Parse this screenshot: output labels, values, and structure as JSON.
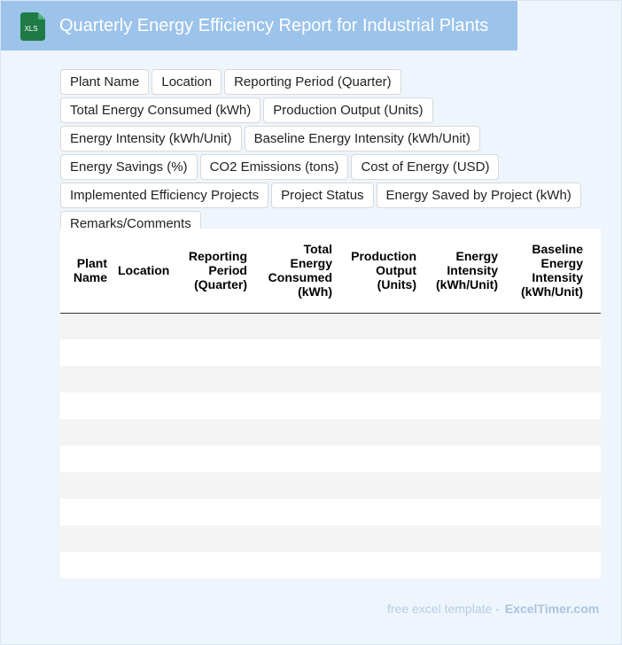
{
  "header": {
    "icon_label": "XLS",
    "title": "Quarterly Energy Efficiency Report for Industrial Plants"
  },
  "fields": [
    "Plant Name",
    "Location",
    "Reporting Period (Quarter)",
    "Total Energy Consumed (kWh)",
    "Production Output (Units)",
    "Energy Intensity (kWh/Unit)",
    "Baseline Energy Intensity (kWh/Unit)",
    "Energy Savings (%)",
    "CO2 Emissions (tons)",
    "Cost of Energy (USD)",
    "Implemented Efficiency Projects",
    "Project Status",
    "Energy Saved by Project (kWh)",
    "Remarks/Comments"
  ],
  "table": {
    "columns": [
      "Plant Name",
      "Location",
      "Reporting Period (Quarter)",
      "Total Energy Consumed (kWh)",
      "Production Output (Units)",
      "Energy Intensity (kWh/Unit)",
      "Baseline Energy Intensity (kWh/Unit)"
    ],
    "rows": [
      [
        "",
        "",
        "",
        "",
        "",
        "",
        ""
      ],
      [
        "",
        "",
        "",
        "",
        "",
        "",
        ""
      ],
      [
        "",
        "",
        "",
        "",
        "",
        "",
        ""
      ],
      [
        "",
        "",
        "",
        "",
        "",
        "",
        ""
      ],
      [
        "",
        "",
        "",
        "",
        "",
        "",
        ""
      ],
      [
        "",
        "",
        "",
        "",
        "",
        "",
        ""
      ],
      [
        "",
        "",
        "",
        "",
        "",
        "",
        ""
      ],
      [
        "",
        "",
        "",
        "",
        "",
        "",
        ""
      ],
      [
        "",
        "",
        "",
        "",
        "",
        "",
        ""
      ],
      [
        "",
        "",
        "",
        "",
        "",
        "",
        ""
      ]
    ]
  },
  "footer": {
    "text": "free excel template -",
    "brand": "ExcelTimer.com"
  },
  "colors": {
    "header_bg": "#9cc3ea",
    "page_bg": "#eef5fd",
    "icon_green": "#1e7b45",
    "row_stripe": "#f4f4f4"
  }
}
